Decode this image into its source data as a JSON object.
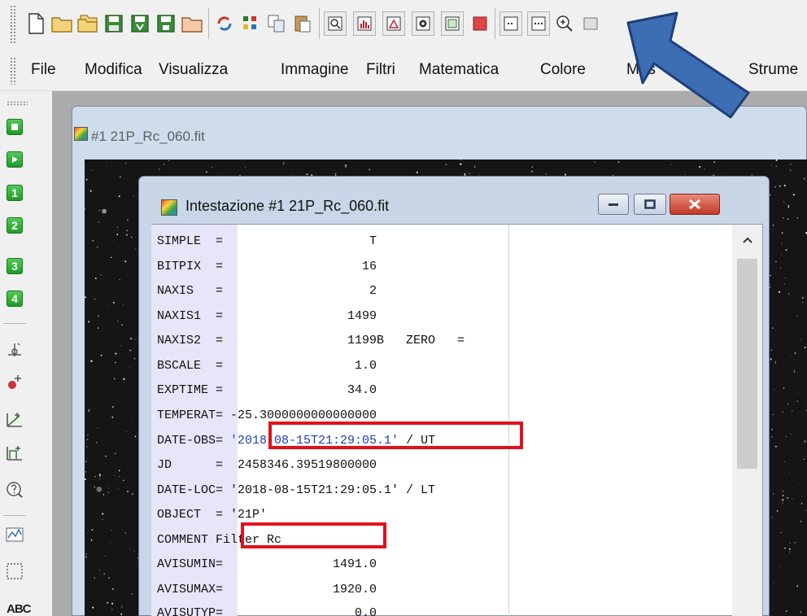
{
  "menu": [
    "File",
    "Modifica",
    "Visualizza",
    "Immagine",
    "Filtri",
    "Matematica",
    "Colore",
    "Mas",
    "Strume"
  ],
  "image_window": {
    "title": "#1 21P_Rc_060.fit"
  },
  "dialog": {
    "title": "Intestazione #1 21P_Rc_060.fit",
    "controls": {
      "minimize": "minimize",
      "maximize": "maximize",
      "close": "close"
    }
  },
  "header_lines": [
    {
      "text": "SIMPLE  =                    T",
      "color": "default"
    },
    {
      "text": "BITPIX  =                   16",
      "color": "default"
    },
    {
      "text": "NAXIS   =                    2",
      "color": "default"
    },
    {
      "text": "NAXIS1  =                 1499",
      "color": "default"
    },
    {
      "text": "NAXIS2  =                 1199B   ZERO   =",
      "color": "default"
    },
    {
      "text": "BSCALE  =                  1.0",
      "color": "default"
    },
    {
      "text": "EXPTIME =                 34.0",
      "color": "default"
    },
    {
      "text": "TEMPERAT= -25.3000000000000000",
      "color": "default"
    },
    {
      "kw": "DATE-OBS= ",
      "val": "'2018-08-15T21:29:05.1'",
      "rest": " / UT",
      "color": "mixed"
    },
    {
      "text": "JD      =  2458346.39519800000",
      "color": "default"
    },
    {
      "text": "DATE-LOC= '2018-08-15T21:29:05.1' / LT",
      "color": "default"
    },
    {
      "text": "OBJECT  = '21P'",
      "color": "default"
    },
    {
      "text": "COMMENT Filter Rc",
      "color": "default"
    },
    {
      "text": "AVISUMIN=               1491.0",
      "color": "default"
    },
    {
      "text": "AVISUMAX=               1920.0",
      "color": "default"
    },
    {
      "text": "AVISUTYP=                  0.0",
      "color": "default"
    }
  ],
  "left_tools": [
    "1",
    "2",
    "3",
    "4"
  ],
  "left_label": "ABC",
  "colors": {
    "annotation_red": "#e0121c",
    "arrow_blue": "#3d6db3",
    "keyword_blue": "#1f3fa8"
  }
}
